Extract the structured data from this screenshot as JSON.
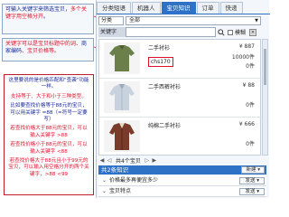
{
  "annotations": {
    "note1": {
      "blue": "可输入关键字来筛选宝贝，",
      "red": "多个关键字用空格分开",
      "end": "。"
    },
    "note2": {
      "red_1": "关键字可以是宝贝标题中的词、",
      "blue": "商家编码",
      "red_2": "、宝贝价格等。"
    },
    "note3": [
      {
        "text": "这里要说的是价格匹配和\"查袭\"功能一样。",
        "color": "blue"
      },
      {
        "text": "支持等于、大于和小于三种类型。",
        "color": "red"
      },
      {
        "text": "比如要查找价格等于88元的宝贝，可以用关键字 =88（=符号一定要写）",
        "color": "blue"
      },
      {
        "text": "若查找价格大于88元的宝贝，可以输入关键字 >88",
        "color": "red"
      },
      {
        "text": "若查找价格小于88元的宝贝，可以输入关键字 <88",
        "color": "red"
      },
      {
        "text": "若查找价格大于88元且小于99元的宝贝，可以输入用空格分开的两个关键字，>88 <99",
        "color": "red"
      }
    ]
  },
  "tabs": [
    {
      "label": "分类短语",
      "active": false
    },
    {
      "label": "机器人",
      "active": false
    },
    {
      "label": "宝贝知识",
      "active": true
    },
    {
      "label": "订单",
      "active": false
    },
    {
      "label": "快递",
      "active": false
    }
  ],
  "filter": {
    "category_label": "分类",
    "category_value": "全部",
    "keyword_label": "关键字",
    "keyword_value": "",
    "fuzzy_label": "模糊",
    "clear_label": "×"
  },
  "products": [
    {
      "name": "二手衬衫",
      "code": "chs170",
      "price": "¥ 887",
      "stock": "10000件",
      "sold": "0件"
    },
    {
      "name": "二手西裤衬衫",
      "code": "",
      "price": "¥ 88",
      "stock": "",
      "sold": "0件"
    },
    {
      "name": "纯棉二手衬衫",
      "code": "",
      "price": "¥ 666",
      "stock": "",
      "sold": "0件"
    }
  ],
  "pager": {
    "first": "◀",
    "prev": "◁",
    "count": "共4个宝贝",
    "next": "▷",
    "last": "▶"
  },
  "knowledge": {
    "header": "共2条知识",
    "new_label": "新建 ▾",
    "items": [
      {
        "label": "价格最多再便宜多少",
        "send": "发送 ▾"
      },
      {
        "label": "宝贝特点",
        "send": "发送 ▾"
      }
    ]
  },
  "colors": {
    "accent": "#2d72c4",
    "red": "#e0102a",
    "blue": "#1a2a9a"
  }
}
